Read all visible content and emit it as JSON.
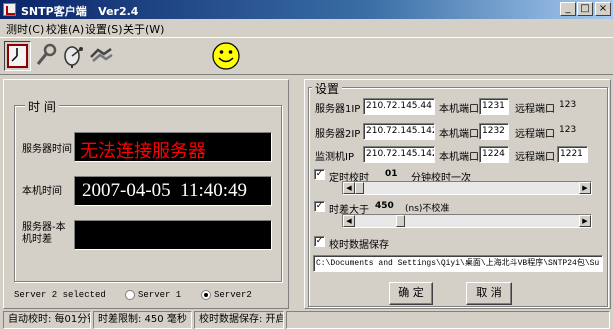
{
  "window": {
    "title": "SNTP客户端   Ver2.4"
  },
  "menu": [
    "测时(C)",
    "校准(A)",
    "设置(S)",
    "关于(W)"
  ],
  "toolbar": {
    "buttons": [
      {
        "icon": "clock-icon",
        "selected": true
      },
      {
        "icon": "wrench-icon",
        "selected": false
      },
      {
        "icon": "satellite-dish-icon",
        "selected": false
      },
      {
        "icon": "handshake-icon",
        "selected": false
      }
    ],
    "status_icon": "smiley-face-icon"
  },
  "time_panel": {
    "title": "时  间",
    "server_time_label": "服务器时间",
    "server_time_value": "无法连接服务器",
    "local_time_label": "本机时间",
    "local_time_value": "2007-04-05  11:40:49",
    "diff_label": "服务器-本机时差",
    "diff_value": ""
  },
  "server_select": {
    "status": "Server 2 selected",
    "options": [
      "Server 1",
      "Server2"
    ],
    "selected_index": 1
  },
  "settings": {
    "title": "设置",
    "rows": [
      {
        "name_label": "服务器1IP",
        "ip": "210.72.145.44",
        "local_port_label": "本机端口",
        "local_port": "1231",
        "remote_port_label": "远程端口",
        "remote_port": "123",
        "remote_editable": false
      },
      {
        "name_label": "服务器2IP",
        "ip": "210.72.145.142",
        "local_port_label": "本机端口",
        "local_port": "1232",
        "remote_port_label": "远程端口",
        "remote_port": "123",
        "remote_editable": false
      },
      {
        "name_label": "监测机IP",
        "ip": "210.72.145.142",
        "local_port_label": "本机端口",
        "local_port": "1224",
        "remote_port_label": "远程端口",
        "remote_port": "1221",
        "remote_editable": true
      }
    ],
    "timing": {
      "label": "定时校时",
      "value": "01",
      "suffix": "分钟校时一次",
      "checked": true,
      "slider_position": 0.0
    },
    "diff": {
      "label": "时差大于",
      "value": "450",
      "suffix": "(ns)不校准",
      "checked": true,
      "slider_position": 0.18
    },
    "save": {
      "label": "校时数据保存",
      "checked": true,
      "path": "C:\\Documents and Settings\\Qiyi\\桌面\\上海北斗VB程序\\SNTP24包\\Su"
    },
    "ok_label": "确 定",
    "cancel_label": "取 消"
  },
  "statusbar": {
    "panes": [
      "自动校时: 每01分钟",
      "时差限制: 450 毫秒",
      "校时数据保存: 开启"
    ]
  },
  "colors": {
    "window_bg": "#d4d0c8",
    "led_bg": "#000000",
    "error_text": "#ff0000",
    "time_text": "#ffffff",
    "title_bar": "#0a246a"
  }
}
